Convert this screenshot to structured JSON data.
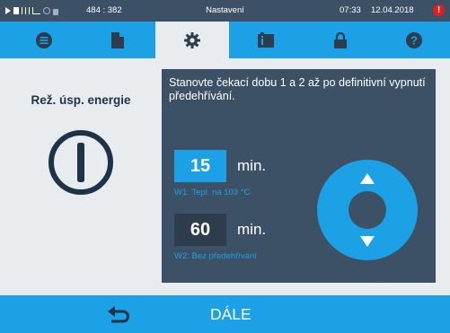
{
  "status_bar": {
    "coords": "484 : 382",
    "title": "Nastavení",
    "time": "07:33",
    "date": "12.04.2018",
    "warning_symbol": "!",
    "icons": [
      "play-icon",
      "document-icon",
      "bars-icon",
      "graph-icon",
      "gear-icon",
      "lock-icon"
    ]
  },
  "tabs": [
    {
      "icon": "list-icon"
    },
    {
      "icon": "document-icon"
    },
    {
      "icon": "gear-icon",
      "active": true
    },
    {
      "icon": "info-card-icon"
    },
    {
      "icon": "lock-icon"
    },
    {
      "icon": "help-icon"
    }
  ],
  "mode": {
    "title": "Rež. úsp. energie",
    "icon": "power-icon"
  },
  "panel": {
    "description": "Stanovte čekací dobu 1 a 2 až po definitivní vypnutí předehřívání.",
    "w1": {
      "value": "15",
      "unit": "min.",
      "caption": "W1: Tepl. na 103 °C"
    },
    "w2": {
      "value": "60",
      "unit": "min.",
      "caption": "W2: Bez předehřívání"
    },
    "dial": {
      "up": "▲",
      "down": "▼"
    }
  },
  "bottom_bar": {
    "next_label": "DÁLE",
    "back_icon": "back-arrow-icon"
  },
  "colors": {
    "accent": "#1ca0e6",
    "dark_panel": "#3d5166",
    "background": "#e9ecef",
    "text_dark": "#1e3348",
    "warning": "#e01e1e"
  }
}
